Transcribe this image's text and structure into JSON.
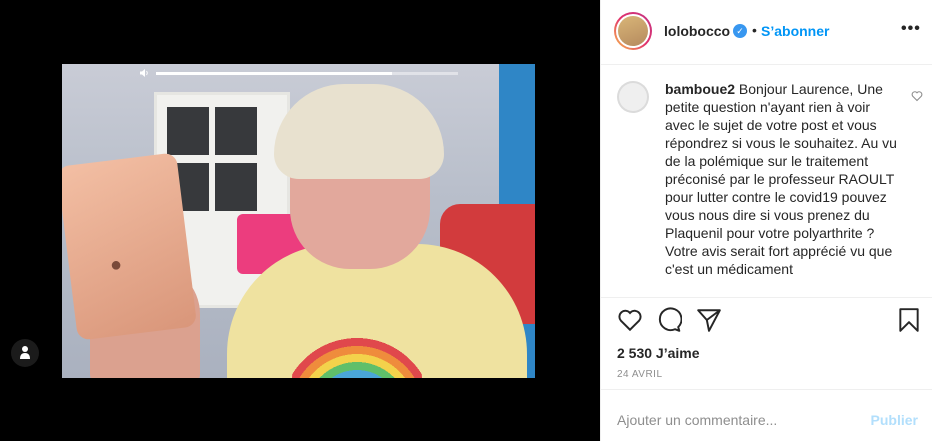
{
  "media": {
    "video_progress": 0.78
  },
  "header": {
    "username": "lolobocco",
    "separator": "•",
    "follow_label": "S’abonner",
    "more_label": "•••"
  },
  "comment": {
    "author": "bamboue2",
    "text": "Bonjour Laurence, Une petite question n'ayant rien à voir avec le sujet de votre post et vous répondrez si vous le souhaitez. Au vu de la polémique sur le traitement préconisé par le professeur RAOULT pour lutter contre le covid19 pouvez vous nous dire si vous prenez du Plaquenil pour votre polyarthrite ? Votre avis serait fort apprécié vu que c'est un médicament"
  },
  "stats": {
    "likes": "2 530 J’aime",
    "date": "24 AVRIL"
  },
  "add_comment": {
    "placeholder": "Ajouter un commentaire...",
    "post_label": "Publier"
  },
  "colors": {
    "follow": "#0095f6",
    "post_disabled": "#b2dffc",
    "verified": "#3897f0"
  }
}
